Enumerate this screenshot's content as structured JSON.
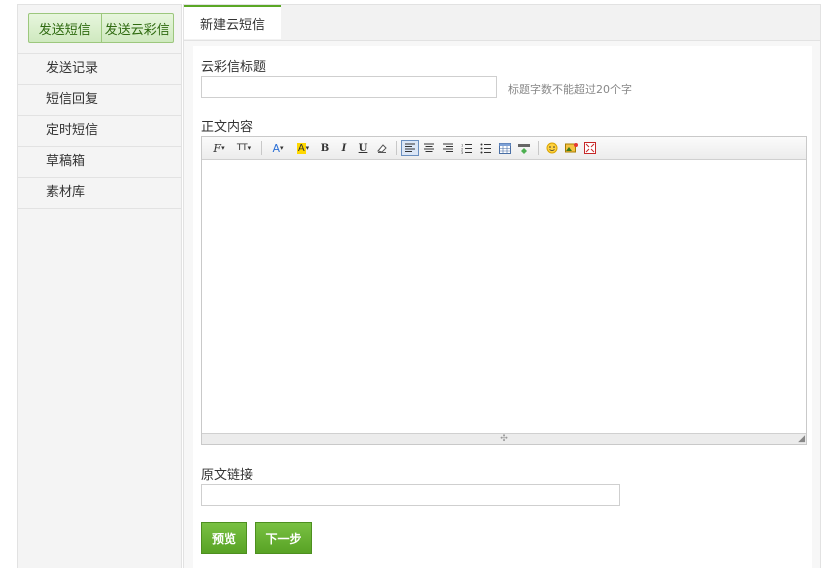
{
  "sidebar": {
    "top_buttons": [
      {
        "label": "发送短信"
      },
      {
        "label": "发送云彩信"
      }
    ],
    "items": [
      {
        "label": "发送记录"
      },
      {
        "label": "短信回复"
      },
      {
        "label": "定时短信"
      },
      {
        "label": "草稿箱"
      },
      {
        "label": "素材库"
      }
    ]
  },
  "tabs": [
    {
      "label": "新建云短信",
      "active": true
    }
  ],
  "form": {
    "title_label": "云彩信标题",
    "title_value": "",
    "title_hint": "标题字数不能超过20个字",
    "content_label": "正文内容",
    "link_label": "原文链接",
    "link_value": ""
  },
  "toolbar": {
    "font_family": "F",
    "font_size": "TT",
    "font_color": "A",
    "bg_color": "A",
    "bold": "B",
    "italic": "I",
    "underline": "U"
  },
  "buttons": {
    "preview": "预览",
    "next": "下一步"
  },
  "colors": {
    "accent": "#5aa725",
    "button_green": "#69b336"
  }
}
